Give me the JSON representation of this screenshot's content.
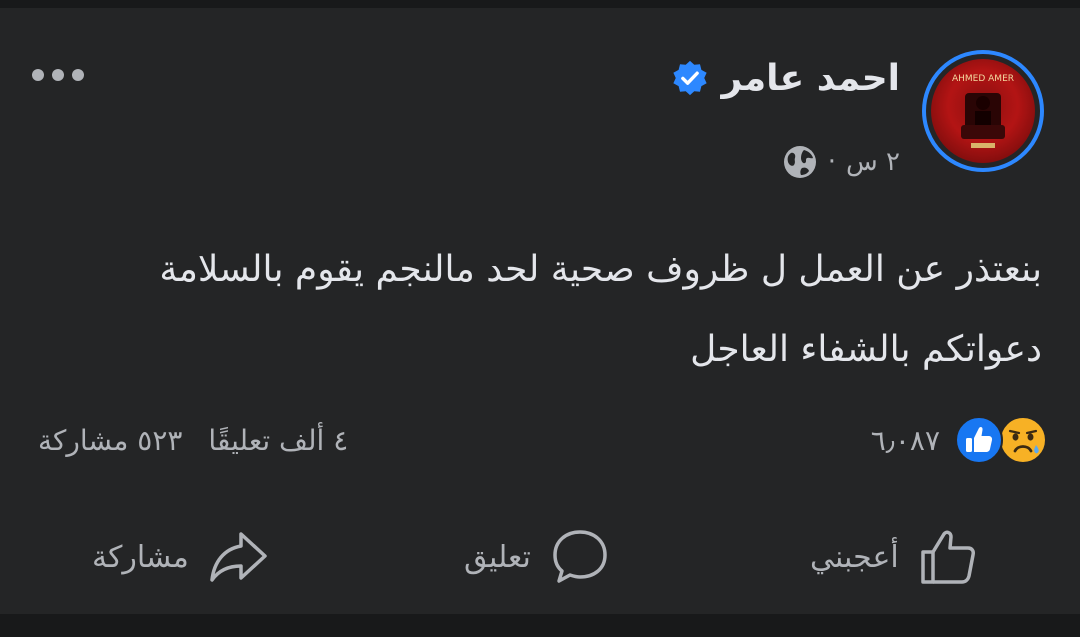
{
  "post": {
    "author_name": "احمد عامر",
    "time": "٢ س",
    "separator": "·",
    "text_lines": [
      "بنعتذر عن العمل ل ظروف صحية لحد مالنجم يقوم بالسلامة",
      "دعواتكم بالشفاء العاجل"
    ]
  },
  "reactions": {
    "count": "٦٫٠٨٧",
    "icons": [
      "sad-face-icon",
      "like-thumb-icon"
    ]
  },
  "stats": {
    "comments": "٤ ألف تعليقًا",
    "shares": "٥٢٣ مشاركة"
  },
  "actions": {
    "like": "أعجبني",
    "comment": "تعليق",
    "share": "مشاركة"
  },
  "colors": {
    "background": "#18191a",
    "card": "#242526",
    "primary_text": "#e4e6eb",
    "secondary_text": "#b0b3b8",
    "accent_blue": "#2d88ff",
    "sad_yellow": "#f7b125"
  }
}
